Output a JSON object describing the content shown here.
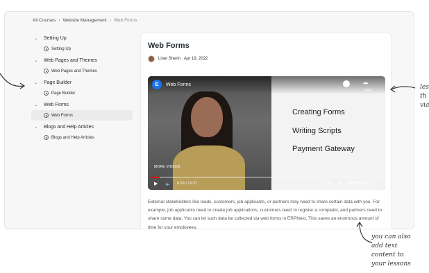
{
  "breadcrumb": {
    "items": [
      "All Courses",
      "Website Management",
      "Web Forms"
    ],
    "separator": "›"
  },
  "sidebar": {
    "sections": [
      {
        "label": "Setting Up",
        "items": [
          {
            "label": "Setting Up",
            "active": false
          }
        ]
      },
      {
        "label": "Web Pages and Themes",
        "items": [
          {
            "label": "Web Pages and Themes",
            "active": false
          }
        ]
      },
      {
        "label": "Page Builder",
        "items": [
          {
            "label": "Page Builder",
            "active": false
          }
        ]
      },
      {
        "label": "Web Forms",
        "items": [
          {
            "label": "Web Forms",
            "active": true
          }
        ]
      },
      {
        "label": "Blogs and Help Articles",
        "items": [
          {
            "label": "Blogs and Help Articles",
            "active": false
          }
        ]
      }
    ]
  },
  "lesson": {
    "title": "Web Forms",
    "author": "Linet Sherin",
    "date": "Apr 19, 2022",
    "body": "External stakeholders like leads, customers, job applicants, or partners may need to share certain data with you. For example, job applicants need to create job applications, customers need to register a complaint, and partners need to share some data. You can let such data be collected via web forms in ERPNext. This saves an enormous amount of time for your employees."
  },
  "video": {
    "logo_letter": "E",
    "title": "Web Forms",
    "slide_lines": [
      "Creating Forms",
      "Writing Scripts",
      "Payment Gateway"
    ],
    "more_videos": "MORE VIDEOS",
    "time": "0:29 / 12:37",
    "progress": 0.038,
    "share_label": "hare",
    "youtube_label": "YouTube"
  },
  "annotations": {
    "right": [
      "les",
      "th",
      "via"
    ],
    "bottom": [
      "you can also",
      "add text",
      "content to",
      "your lessons"
    ]
  },
  "colors": {
    "accent": "#ff0000",
    "page_bg": "#f7f7f7",
    "card_bg": "#ffffff"
  }
}
